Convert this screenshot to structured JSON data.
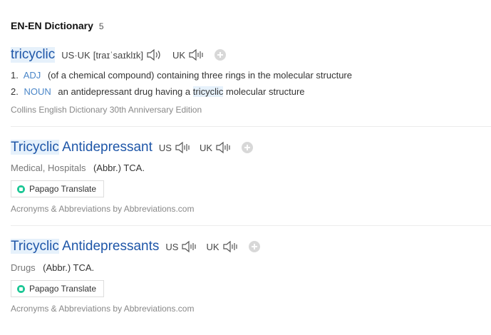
{
  "section": {
    "title": "EN-EN Dictionary",
    "count": "5"
  },
  "entries": [
    {
      "headword": "tricyclic",
      "pron_label_1": "US·UK",
      "ipa": "[traɪˈsaɪklɪk]",
      "pron_label_2": "UK",
      "senses": [
        {
          "num": "1.",
          "pos": "ADJ",
          "text": "(of a chemical compound) containing three rings in the molecular structure"
        },
        {
          "num": "2.",
          "pos": "NOUN",
          "text_before": "an antidepressant drug having a",
          "text_highlight": "tricyclic",
          "text_after": "molecular structure"
        }
      ],
      "source": "Collins English Dictionary 30th Anniversary Edition"
    },
    {
      "headword_highlight": "Tricyclic",
      "headword_rest": "Antidepressant",
      "pron_label_1": "US",
      "pron_label_2": "UK",
      "field": "Medical, Hospitals",
      "definition": "(Abbr.) TCA.",
      "translate_button": "Papago Translate",
      "source": "Acronyms & Abbreviations by Abbreviations.com"
    },
    {
      "headword_highlight": "Tricyclic",
      "headword_rest": "Antidepressants",
      "pron_label_1": "US",
      "pron_label_2": "UK",
      "field": "Drugs",
      "definition": "(Abbr.) TCA.",
      "translate_button": "Papago Translate",
      "source": "Acronyms & Abbreviations by Abbreviations.com"
    }
  ],
  "icons": {
    "speaker": "speaker-icon",
    "add": "plus-circle-icon",
    "papago": "papago-logo-icon"
  },
  "colors": {
    "headword": "#1e56a8",
    "highlight_bg": "#e6f1fb",
    "pos": "#4a86c8",
    "papago": "#1ec796"
  }
}
